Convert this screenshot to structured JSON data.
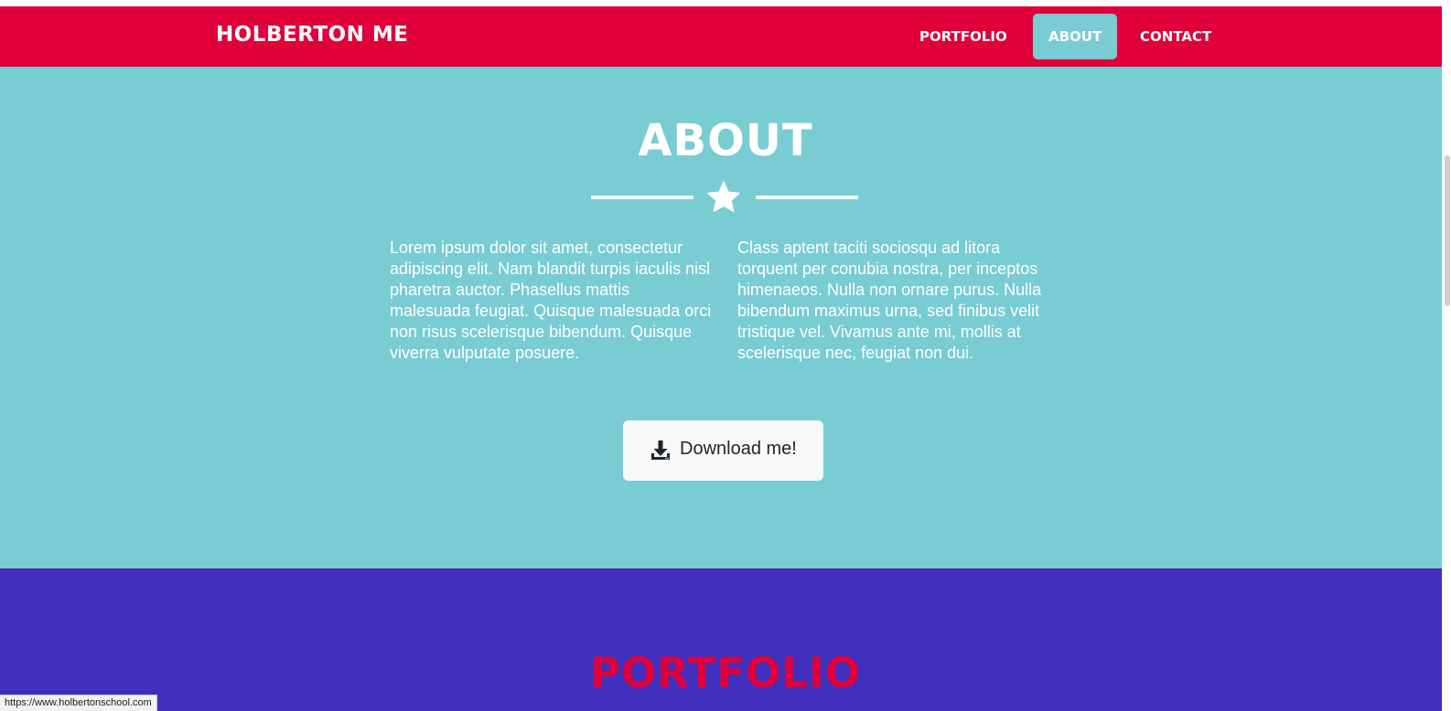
{
  "navbar": {
    "brand": "HOLBERTON ME",
    "links": [
      {
        "label": "PORTFOLIO",
        "active": false
      },
      {
        "label": "ABOUT",
        "active": true
      },
      {
        "label": "CONTACT",
        "active": false
      }
    ]
  },
  "about": {
    "title": "ABOUT",
    "divider_icon": "star-icon",
    "paragraphs": [
      "Lorem ipsum dolor sit amet, consectetur adipiscing elit. Nam blandit turpis iaculis nisl pharetra auctor. Phasellus mattis malesuada feugiat. Quisque malesuada orci non risus scelerisque bibendum. Quisque viverra vulputate posuere.",
      "Class aptent taciti sociosqu ad litora torquent per conubia nostra, per inceptos himenaeos. Nulla non ornare purus. Nulla bibendum maximus urna, sed finibus velit tristique vel. Vivamus ante mi, mollis at scelerisque nec, feugiat non dui."
    ],
    "download_button": {
      "label": "Download me!",
      "icon": "download-icon"
    }
  },
  "portfolio": {
    "title": "PORTFOLIO"
  },
  "status_bar": {
    "url": "https://www.holbertonschool.com"
  },
  "colors": {
    "navbar_bg": "#e0003a",
    "about_bg": "#78ccd2",
    "portfolio_bg": "#4030bd",
    "portfolio_title": "#e0003a",
    "button_bg": "#f8f9fa"
  }
}
